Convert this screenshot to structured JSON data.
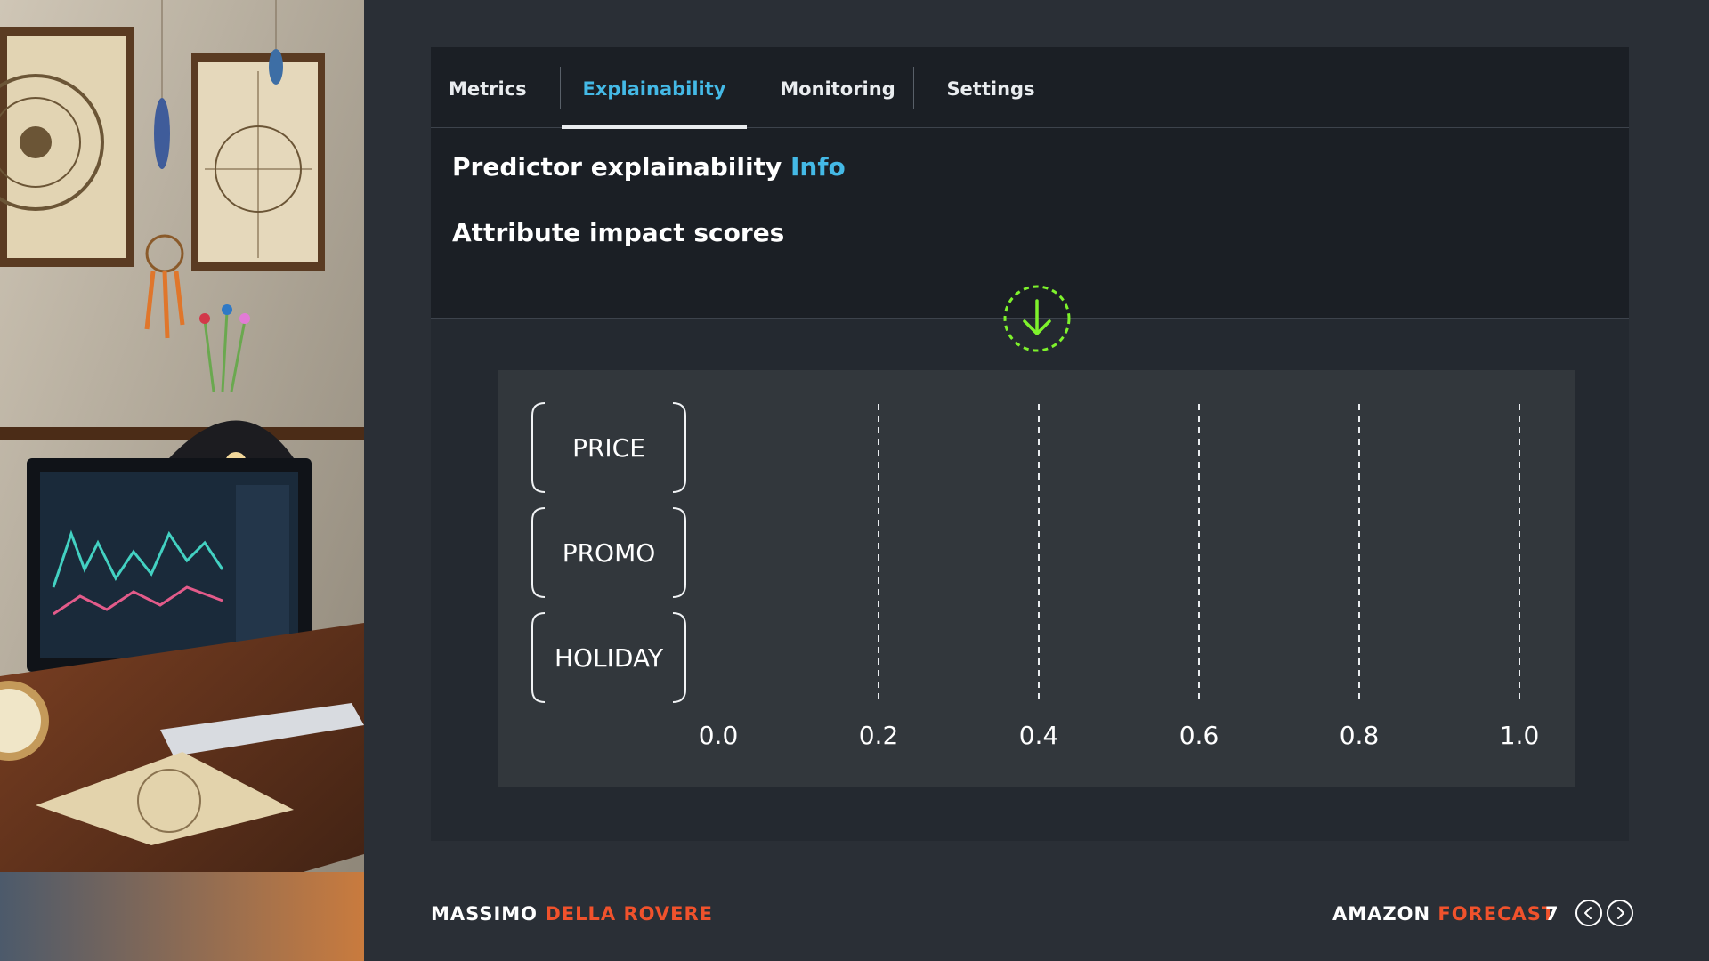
{
  "tabs": [
    {
      "label": "Metrics",
      "active": false
    },
    {
      "label": "Explainability",
      "active": true
    },
    {
      "label": "Monitoring",
      "active": false
    },
    {
      "label": "Settings",
      "active": false
    }
  ],
  "explainability": {
    "title": "Predictor explainability",
    "info_label": "Info",
    "section_title": "Attribute impact scores"
  },
  "icons": {
    "download": "download-arrow-icon",
    "prev": "chevron-left-icon",
    "next": "chevron-right-icon"
  },
  "chart_data": {
    "type": "bar",
    "categories": [
      "PRICE",
      "PROMO",
      "HOLIDAY"
    ],
    "values": [
      null,
      null,
      null
    ],
    "xticks": [
      "0.0",
      "0.2",
      "0.4",
      "0.6",
      "0.8",
      "1.0"
    ],
    "xlim": [
      0.0,
      1.0
    ],
    "grid": true,
    "title": "",
    "xlabel": "",
    "ylabel": ""
  },
  "footer": {
    "author_first": "MASSIMO",
    "author_last": "DELLA ROVERE",
    "product_first": "AMAZON",
    "product_last": "FORECAST",
    "page_number": "7"
  },
  "colors": {
    "accent_orange": "#f0522c",
    "link_blue": "#44b9e6",
    "download_green": "#7ef22c",
    "panel_bg": "#1b1f25",
    "page_bg": "#2a2f36"
  }
}
